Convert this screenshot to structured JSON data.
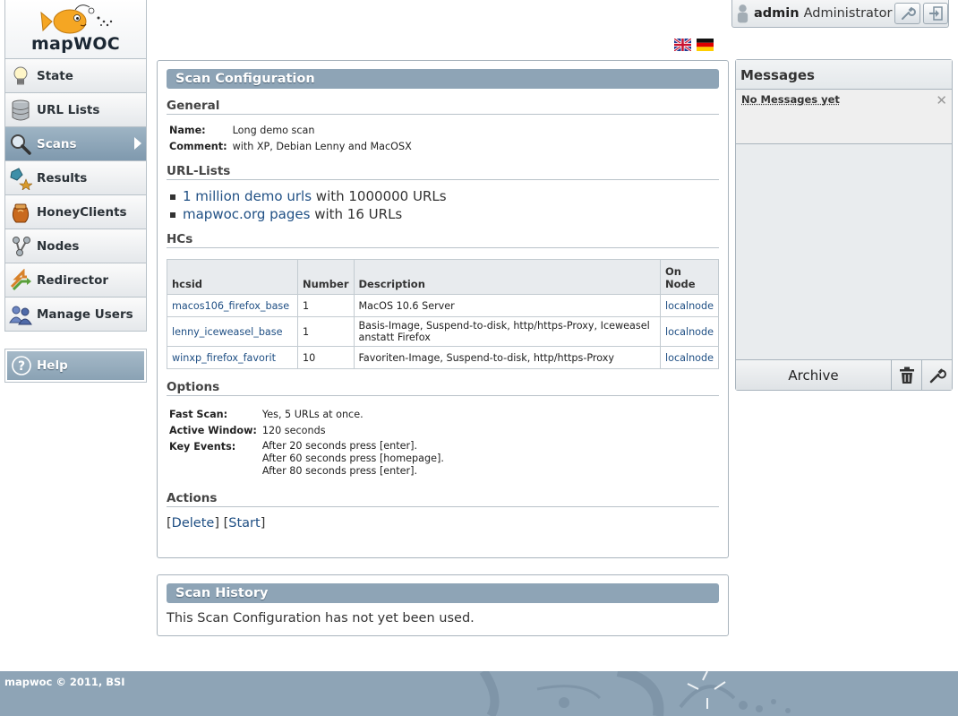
{
  "logo": {
    "text": "mapWOC"
  },
  "sidebar": {
    "items": [
      {
        "label": "State",
        "icon": "lightbulb-icon",
        "active": false
      },
      {
        "label": "URL Lists",
        "icon": "database-icon",
        "active": false
      },
      {
        "label": "Scans",
        "icon": "magnifier-icon",
        "active": true
      },
      {
        "label": "Results",
        "icon": "results-icon",
        "active": false
      },
      {
        "label": "HoneyClients",
        "icon": "honeypot-icon",
        "active": false
      },
      {
        "label": "Nodes",
        "icon": "nodes-icon",
        "active": false
      },
      {
        "label": "Redirector",
        "icon": "redirector-icon",
        "active": false
      },
      {
        "label": "Manage Users",
        "icon": "users-icon",
        "active": false
      }
    ],
    "help_label": "Help"
  },
  "user": {
    "name": "admin",
    "role": "Administrator"
  },
  "scan_config": {
    "title": "Scan Configuration",
    "general": {
      "heading": "General",
      "name_label": "Name:",
      "name_value": "Long demo scan",
      "comment_label": "Comment:",
      "comment_value": "with XP, Debian Lenny and MacOSX"
    },
    "url_lists": {
      "heading": "URL-Lists",
      "items": [
        {
          "link": "1 million demo urls",
          "suffix": "with 1000000 URLs"
        },
        {
          "link": "mapwoc.org pages",
          "suffix": "with 16 URLs"
        }
      ]
    },
    "hcs": {
      "heading": "HCs",
      "columns": [
        "hcsid",
        "Number",
        "Description",
        "On Node"
      ],
      "rows": [
        {
          "hcsid": "macos106_firefox_base",
          "number": "1",
          "description": "MacOS 10.6 Server",
          "node": "localnode"
        },
        {
          "hcsid": "lenny_iceweasel_base",
          "number": "1",
          "description": "Basis-Image, Suspend-to-disk, http/https-Proxy, Iceweasel anstatt Firefox",
          "node": "localnode"
        },
        {
          "hcsid": "winxp_firefox_favorit",
          "number": "10",
          "description": "Favoriten-Image, Suspend-to-disk, http/https-Proxy",
          "node": "localnode"
        }
      ]
    },
    "options": {
      "heading": "Options",
      "fast_scan_label": "Fast Scan:",
      "fast_scan_value": "Yes, 5 URLs at once.",
      "active_window_label": "Active Window:",
      "active_window_value": "120 seconds",
      "key_events_label": "Key Events:",
      "key_events": [
        "After 20 seconds press [enter].",
        "After 60 seconds press [homepage].",
        "After 80 seconds press [enter]."
      ]
    },
    "actions": {
      "heading": "Actions",
      "delete_label": "Delete",
      "start_label": "Start"
    }
  },
  "scan_history": {
    "title": "Scan History",
    "text": "This Scan Configuration has not yet been used."
  },
  "messages": {
    "title": "Messages",
    "empty_text": "No Messages yet",
    "archive_label": "Archive"
  },
  "footer": {
    "text": "mapwoc © 2011, BSI"
  }
}
